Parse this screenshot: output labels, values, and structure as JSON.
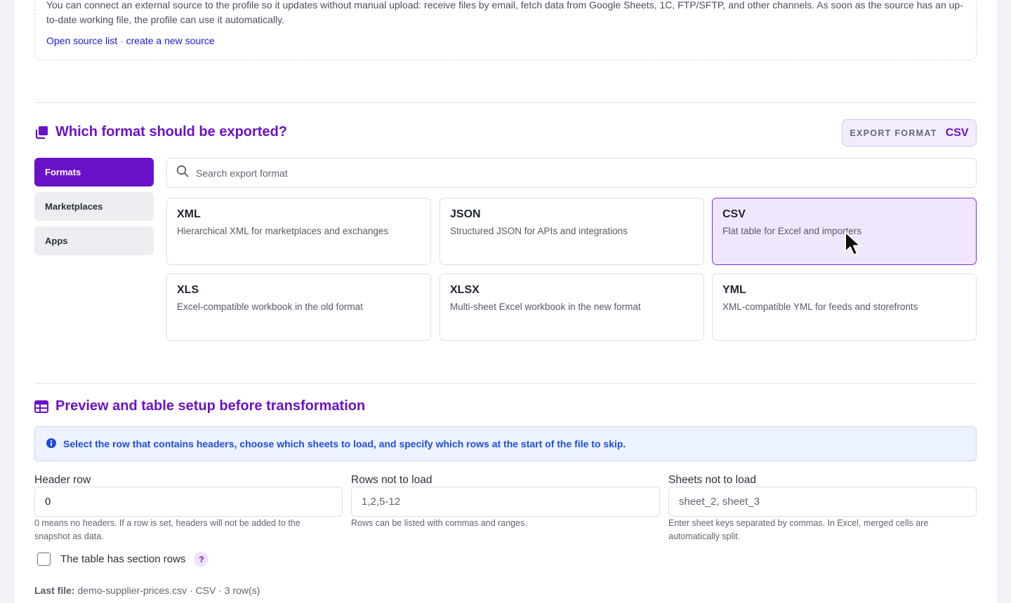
{
  "source": {
    "description": "You can connect an external source to the profile so it updates without manual upload: receive files by email, fetch data from Google Sheets, 1C, FTP/SFTP, and other channels. As soon as the source has an up-to-date working file, the profile can use it automatically.",
    "link_open": "Open source list",
    "separator": " · ",
    "link_create": "create a new source"
  },
  "format_section": {
    "title": "Which format should be exported?",
    "export_label": "EXPORT FORMAT",
    "export_value": "CSV",
    "tabs": [
      {
        "label": "Formats",
        "active": true
      },
      {
        "label": "Marketplaces",
        "active": false
      },
      {
        "label": "Apps",
        "active": false
      }
    ],
    "search_placeholder": "Search export format",
    "formats": [
      {
        "name": "XML",
        "desc": "Hierarchical XML for marketplaces and exchanges"
      },
      {
        "name": "JSON",
        "desc": "Structured JSON for APIs and integrations"
      },
      {
        "name": "CSV",
        "desc": "Flat table for Excel and importers",
        "selected": true
      },
      {
        "name": "XLS",
        "desc": "Excel-compatible workbook in the old format"
      },
      {
        "name": "XLSX",
        "desc": "Multi-sheet Excel workbook in the new format"
      },
      {
        "name": "YML",
        "desc": "XML-compatible YML for feeds and storefronts"
      }
    ]
  },
  "preview_section": {
    "title": "Preview and table setup before transformation",
    "info": "Select the row that contains headers, choose which sheets to load, and specify which rows at the start of the file to skip.",
    "header_row": {
      "label": "Header row",
      "value": "0",
      "hint": "0 means no headers. If a row is set, headers will not be added to the snapshot as data."
    },
    "rows_not_load": {
      "label": "Rows not to load",
      "placeholder": "1,2,5-12",
      "hint": "Rows can be listed with commas and ranges."
    },
    "sheets_not_load": {
      "label": "Sheets not to load",
      "placeholder": "sheet_2, sheet_3",
      "hint": "Enter sheet keys separated by commas. In Excel, merged cells are automatically split."
    },
    "section_rows_label": "The table has section rows",
    "help": "?",
    "last_file_label": "Last file:",
    "last_file_value": "demo-supplier-prices.csv · CSV · 3 row(s)"
  },
  "colors": {
    "accent": "#6a12c9",
    "info": "#1d4ed8",
    "selected_bg": "#f1e7fc"
  }
}
